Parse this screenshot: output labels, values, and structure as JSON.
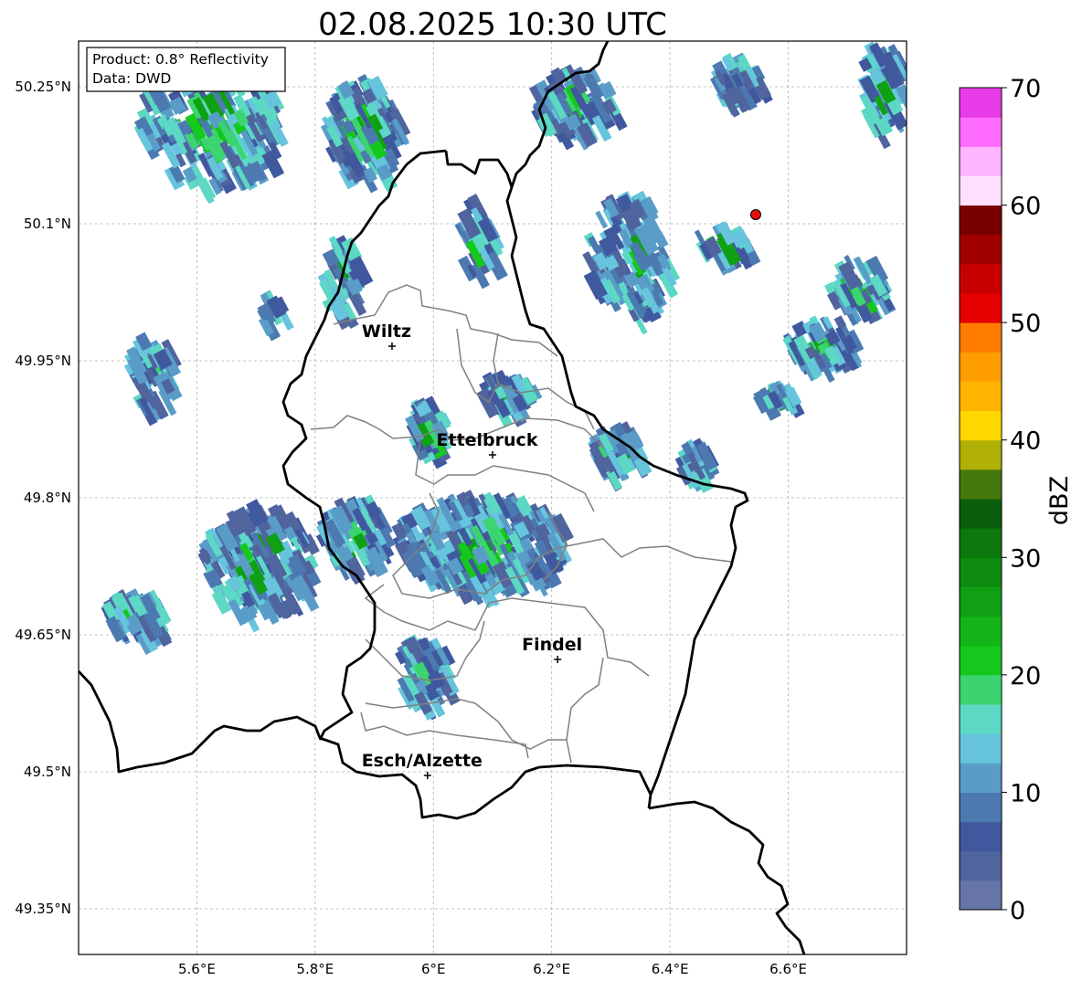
{
  "title": "02.08.2025 10:30 UTC",
  "info": {
    "product": "Product: 0.8° Reflectivity",
    "data": "Data: DWD"
  },
  "x_ticks": [
    {
      "value": 5.6,
      "label": "5.6°E"
    },
    {
      "value": 5.8,
      "label": "5.8°E"
    },
    {
      "value": 6.0,
      "label": "6°E"
    },
    {
      "value": 6.2,
      "label": "6.2°E"
    },
    {
      "value": 6.4,
      "label": "6.4°E"
    },
    {
      "value": 6.6,
      "label": "6.6°E"
    }
  ],
  "y_ticks": [
    {
      "value": 50.25,
      "label": "50.25°N"
    },
    {
      "value": 50.1,
      "label": "50.1°N"
    },
    {
      "value": 49.95,
      "label": "49.95°N"
    },
    {
      "value": 49.8,
      "label": "49.8°N"
    },
    {
      "value": 49.65,
      "label": "49.65°N"
    },
    {
      "value": 49.5,
      "label": "49.5°N"
    },
    {
      "value": 49.35,
      "label": "49.35°N"
    }
  ],
  "extent": {
    "lon": [
      5.4,
      6.8
    ],
    "lat": [
      49.3,
      50.3
    ]
  },
  "cities": [
    {
      "name": "Wiltz",
      "lon": 5.93,
      "lat": 49.966
    },
    {
      "name": "Ettelbruck",
      "lon": 6.1,
      "lat": 49.847
    },
    {
      "name": "Findel",
      "lon": 6.21,
      "lat": 49.623
    },
    {
      "name": "Esch/Alzette",
      "lon": 5.99,
      "lat": 49.496
    }
  ],
  "red_marker": {
    "lon": 6.545,
    "lat": 50.11
  },
  "colorbar": {
    "label": "dBZ",
    "ticks": [
      {
        "value": 0,
        "label": "0"
      },
      {
        "value": 10,
        "label": "10"
      },
      {
        "value": 20,
        "label": "20"
      },
      {
        "value": 30,
        "label": "30"
      },
      {
        "value": 40,
        "label": "40"
      },
      {
        "value": 50,
        "label": "50"
      },
      {
        "value": 60,
        "label": "60"
      },
      {
        "value": 70,
        "label": "70"
      }
    ],
    "colors": [
      "#6674a8",
      "#50649e",
      "#40589e",
      "#4c7ab0",
      "#5a9cc8",
      "#66c4dc",
      "#5cd8c4",
      "#3cd470",
      "#14c81c",
      "#12b418",
      "#10a014",
      "#0e8c10",
      "#0c780e",
      "#0a5e0c",
      "#44780c",
      "#b0b006",
      "#ffd800",
      "#ffb400",
      "#ff9c00",
      "#ff7c00",
      "#e60000",
      "#c80000",
      "#a20000",
      "#780000",
      "#ffe0ff",
      "#ffb4ff",
      "#ff6cff",
      "#e83ce8"
    ]
  },
  "colors": {
    "frame": "#000000",
    "grid": "#b0b0b0",
    "border": "#000000",
    "canton": "#808080",
    "marker": "#e01010"
  }
}
